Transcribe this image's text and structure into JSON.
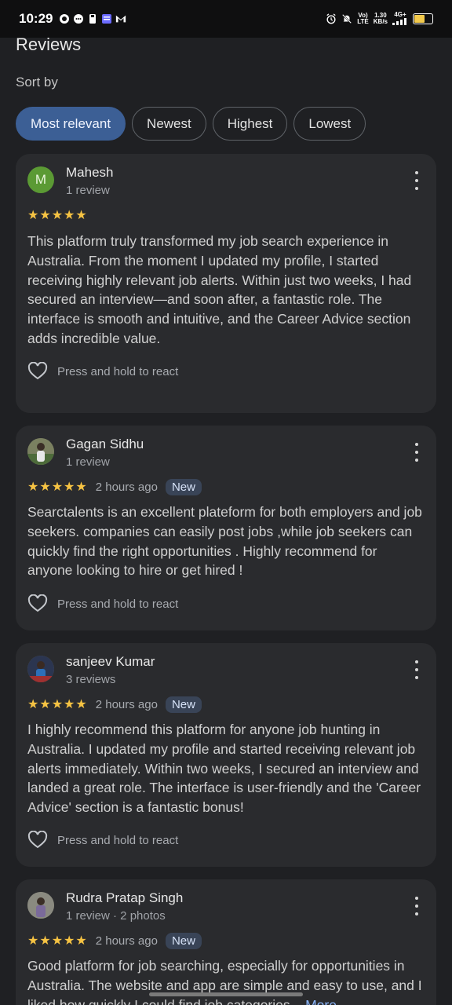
{
  "status_bar": {
    "time": "10:29",
    "net_label_top": "Vo)",
    "net_label_bottom": "LTE",
    "speed_top": "1.30",
    "speed_bottom": "KB/s",
    "signal_label": "4G+",
    "icons": [
      "whatsapp-icon",
      "chat-icon",
      "sim-icon",
      "app-icon",
      "gmail-icon",
      "alarm-icon",
      "mute-icon",
      "signal-icon",
      "battery-icon"
    ]
  },
  "header": {
    "title": "Reviews",
    "sort_label": "Sort by"
  },
  "sort_chips": [
    {
      "label": "Most relevant",
      "active": true
    },
    {
      "label": "Newest",
      "active": false
    },
    {
      "label": "Highest",
      "active": false
    },
    {
      "label": "Lowest",
      "active": false
    }
  ],
  "reviews": [
    {
      "name": "Mahesh",
      "avatar_letter": "M",
      "meta": "1 review",
      "stars": "★★★★★",
      "rating": 5,
      "time": "",
      "badge": "",
      "text": "This platform truly transformed my job search experience in Australia. From the moment I updated my profile, I started receiving highly relevant job alerts. Within just two weeks, I had secured an interview—and soon after, a fantastic role. The interface is smooth and intuitive, and the Career Advice section adds incredible value.",
      "react_label": "Press and hold to react"
    },
    {
      "name": "Gagan Sidhu",
      "meta": "1 review",
      "stars": "★★★★★",
      "rating": 5,
      "time": "2 hours ago",
      "badge": "New",
      "text": "Searctalents is an excellent plateform for both employers and job seekers. companies can easily post jobs ,while job seekers can quickly find the right opportunities . Highly recommend for anyone looking to hire or get hired !",
      "react_label": "Press and hold to react"
    },
    {
      "name": "sanjeev Kumar",
      "meta": "3 reviews",
      "stars": "★★★★★",
      "rating": 5,
      "time": "2 hours ago",
      "badge": "New",
      "text": "I highly recommend this platform for anyone job hunting in Australia. I updated my profile and started receiving relevant job alerts immediately. Within two weeks, I secured an interview and landed a great role. The interface is user-friendly and the 'Career Advice' section is a fantastic bonus!",
      "react_label": "Press and hold to react"
    },
    {
      "name": "Rudra Pratap Singh",
      "meta": "1 review · 2 photos",
      "stars": "★★★★★",
      "rating": 5,
      "time": "2 hours ago",
      "badge": "New",
      "text": "Good platform for job searching, especially for opportunities in Australia. The website and app are simple and easy to use, and I liked how quickly I could find job categories...",
      "more_label": "More"
    }
  ],
  "colors": {
    "background": "#1f2023",
    "card": "#2a2b2e",
    "accent_chip": "#3c5f95",
    "star": "#f6c343",
    "link": "#8ab4f8"
  }
}
